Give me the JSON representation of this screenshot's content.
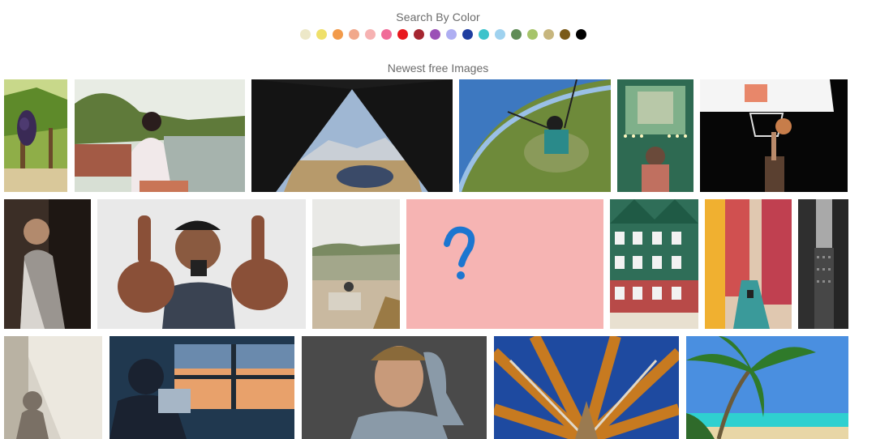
{
  "search_by_color": {
    "title": "Search By Color",
    "colors": [
      "#ede8c8",
      "#efe06a",
      "#f29a4a",
      "#f1a88b",
      "#f6b2b2",
      "#f06b98",
      "#e8171c",
      "#a52630",
      "#9b51b6",
      "#aeaef2",
      "#1f3ea0",
      "#3cc3cb",
      "#9fd2ef",
      "#5f8c56",
      "#a6c46a",
      "#c7b67e",
      "#7a5a18",
      "#000000"
    ]
  },
  "newest": {
    "title": "Newest free Images",
    "images": [
      {
        "subject": "vineyard-grapes"
      },
      {
        "subject": "woman-by-lake"
      },
      {
        "subject": "tent-mountain-view"
      },
      {
        "subject": "paragliding"
      },
      {
        "subject": "woman-mirror-lights"
      },
      {
        "subject": "basketball-hoop"
      },
      {
        "subject": "woman-looking-up"
      },
      {
        "subject": "man-thumbs-up"
      },
      {
        "subject": "countryside-landscape"
      },
      {
        "subject": "question-mark-pink"
      },
      {
        "subject": "green-houses"
      },
      {
        "subject": "venice-canal"
      },
      {
        "subject": "tall-buildings"
      },
      {
        "subject": "buddha-statue"
      },
      {
        "subject": "man-window-sunset"
      },
      {
        "subject": "man-thinking"
      },
      {
        "subject": "trees-from-below"
      },
      {
        "subject": "palm-beach"
      }
    ]
  }
}
